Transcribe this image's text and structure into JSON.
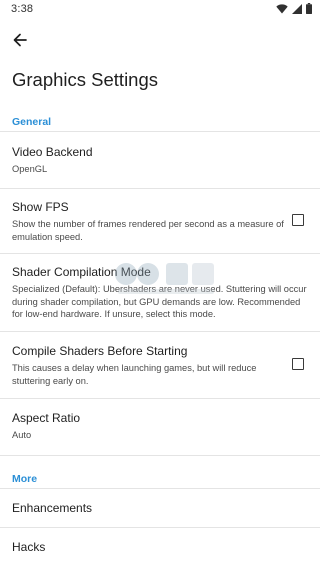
{
  "status_bar": {
    "time": "3:38",
    "icons": [
      "wifi-icon",
      "signal-icon",
      "battery-icon"
    ]
  },
  "header": {
    "back_icon": "arrow-left-icon",
    "title": "Graphics Settings"
  },
  "sections": {
    "general": {
      "label": "General",
      "items": [
        {
          "title": "Video Backend",
          "summary": "OpenGL"
        },
        {
          "title": "Show FPS",
          "summary": "Show the number of frames rendered per second as a measure of emulation speed.",
          "checked": false
        },
        {
          "title": "Shader Compilation Mode",
          "summary": "Specialized (Default): Ubershaders are never used. Stuttering will occur during shader compilation, but GPU demands are low. Recommended for low-end hardware. If unsure, select this mode."
        },
        {
          "title": "Compile Shaders Before Starting",
          "summary": "This causes a delay when launching games, but will reduce stuttering early on.",
          "checked": false
        },
        {
          "title": "Aspect Ratio",
          "summary": "Auto"
        }
      ]
    },
    "more": {
      "label": "More",
      "items": [
        {
          "title": "Enhancements"
        },
        {
          "title": "Hacks"
        }
      ]
    }
  },
  "colors": {
    "accent": "#2b8fd6",
    "divider": "#e4e4e4",
    "text_primary": "#1f1f1f",
    "text_secondary": "#4a4a4a"
  }
}
